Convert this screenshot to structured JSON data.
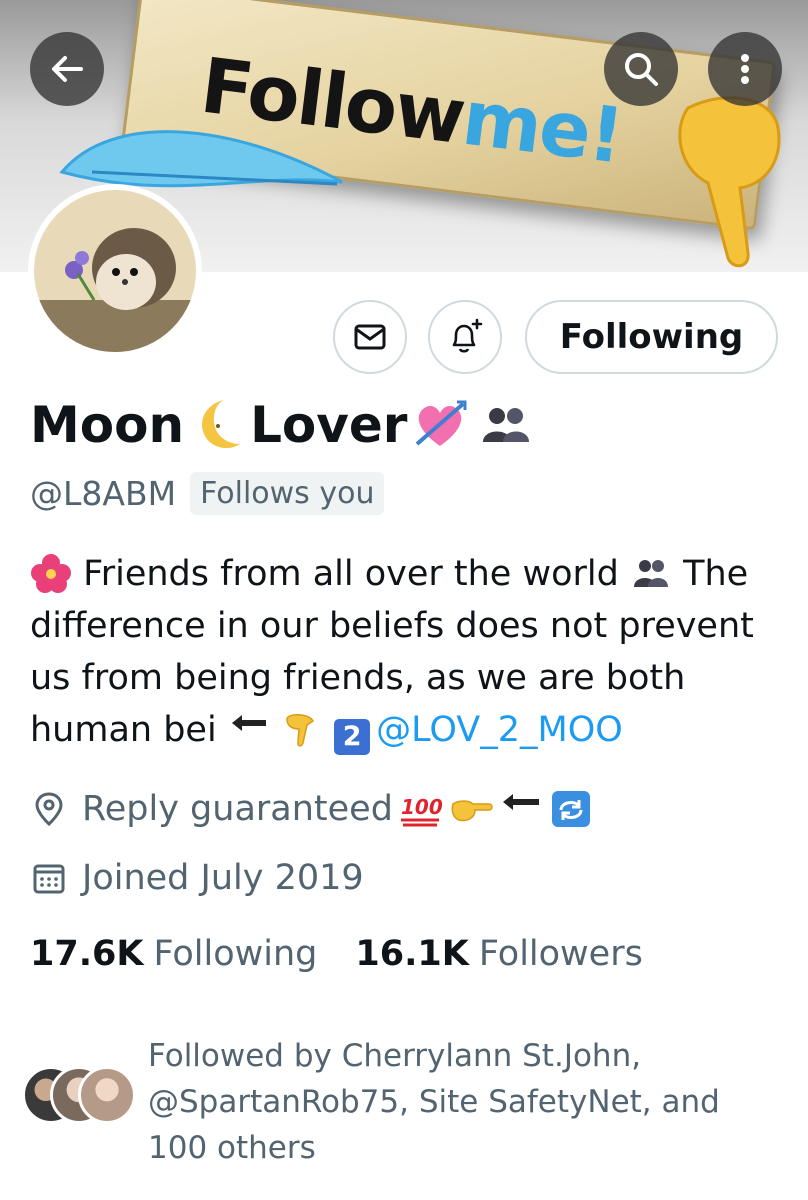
{
  "banner": {
    "sign_text_main": "Follow",
    "sign_text_accent": "me!"
  },
  "nav": {
    "back_icon": "arrow-left-icon",
    "search_icon": "search-icon",
    "more_icon": "more-vertical-icon"
  },
  "actions": {
    "message_icon": "envelope-icon",
    "notify_icon": "bell-plus-icon",
    "following_label": "Following"
  },
  "profile": {
    "name_part1": "Moon",
    "name_part2": "Lover",
    "handle": "@L8ABM",
    "follows_you": "Follows you"
  },
  "bio": {
    "line_part1": "Friends from all over the world",
    "line_part2": "The difference in our beliefs does not prevent us from being friends, as we are both human bei",
    "mention": "@LOV_2_MOO",
    "keycap_number": "2"
  },
  "meta": {
    "location": "Reply guaranteed",
    "joined": "Joined July 2019"
  },
  "stats": {
    "following_count": "17.6K",
    "following_label": "Following",
    "followers_count": "16.1K",
    "followers_label": "Followers"
  },
  "followed_by": {
    "text": "Followed by Cherrylann St.John, @SpartanRob75, Site SafetyNet, and 100 others"
  },
  "colors": {
    "link": "#1d9bf0",
    "secondary_text": "#536471",
    "primary_text": "#0f1419",
    "border": "#cfd9de"
  }
}
